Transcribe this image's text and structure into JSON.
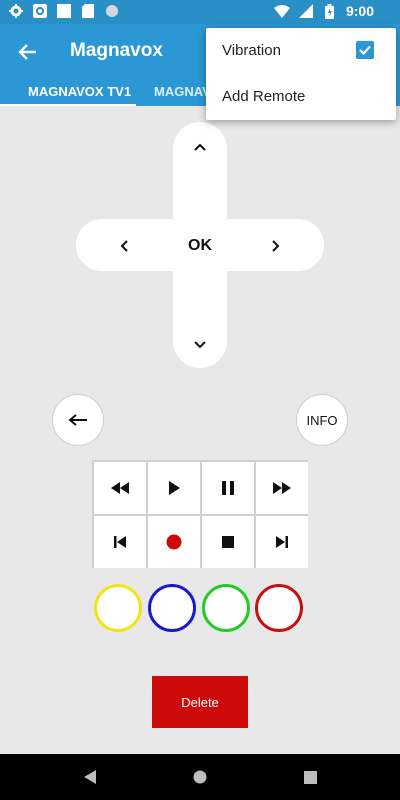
{
  "status_bar": {
    "time": "9:00",
    "icons": [
      "gear-icon",
      "p-app-icon",
      "white-square-icon",
      "sd-card-icon",
      "circle-icon",
      "wifi-icon",
      "signal-icon",
      "battery-icon"
    ]
  },
  "app_bar": {
    "title": "Magnavox",
    "back_icon": "arrow-left-icon"
  },
  "tabs": [
    {
      "label": "MAGNAVOX TV1",
      "selected": true
    },
    {
      "label": "MAGNAVOX TV2",
      "selected": false
    }
  ],
  "menu": {
    "items": [
      {
        "label": "Vibration",
        "checked": true
      },
      {
        "label": "Add Remote"
      }
    ]
  },
  "remote": {
    "dpad": {
      "ok_label": "OK"
    },
    "info_label": "INFO",
    "media_buttons": [
      "rewind-icon",
      "play-icon",
      "pause-icon",
      "fast-forward-icon",
      "skip-previous-icon",
      "record-icon",
      "stop-icon",
      "skip-next-icon"
    ],
    "color_buttons": [
      "#f2e316",
      "#1a1acc",
      "#22cc22",
      "#c41212"
    ],
    "delete_label": "Delete"
  },
  "colors": {
    "status_bar": "#2b8fc7",
    "app_bar": "#2b97d4",
    "record": "#cc0a0a",
    "delete": "#cc0a0a"
  }
}
